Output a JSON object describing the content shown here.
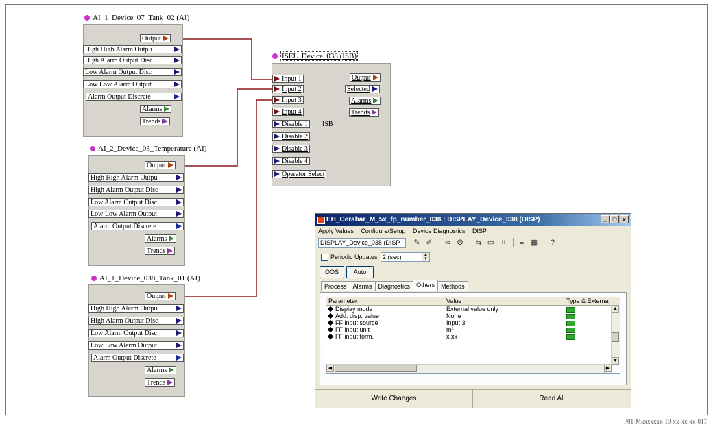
{
  "figure_ref": "P01-Mxxxxxxx-19-xx-xx-xx-017",
  "block_ai_tank02": {
    "title": "AI_1_Device_07_Tank_02 (AI)",
    "outputs": [
      "Output",
      "High High Alarm Outpu",
      "High Alarm Output Disc",
      "Low Alarm Output Disc",
      "Low Low Alarm Output",
      "Alarm Output Discrete",
      "Alarms",
      "Trends"
    ]
  },
  "block_ai_temp": {
    "title": "AI_2_Device_03_Temperature (AI)",
    "outputs": [
      "Output",
      "High High Alarm Outpu",
      "High Alarm Output Disc",
      "Low Alarm Output Disc",
      "Low Low Alarm Output",
      "Alarm Output Discrete",
      "Alarms",
      "Trends"
    ]
  },
  "block_ai_tank01": {
    "title": "AI_1_Device_038_Tank_01 (AI)",
    "outputs": [
      "Output",
      "High High Alarm Outpu",
      "High Alarm Output Disc",
      "Low Alarm Output Disc",
      "Low Low Alarm Output",
      "Alarm Output Discrete",
      "Alarms",
      "Trends"
    ]
  },
  "block_isel": {
    "title": "ISEL_Device_038 (ISB)",
    "inputs": [
      "Input 1",
      "Input 2",
      "Input 3",
      "Input 4",
      "Disable 1",
      "Disable 2",
      "Disable 3",
      "Disable 4",
      "Operator Select"
    ],
    "outputs": [
      "Output",
      "Selected",
      "Alarms",
      "Trends"
    ],
    "tag": "ISB"
  },
  "dialog": {
    "title": "EH_Cerabar_M_5x_fp_number_038 : DISPLAY_Device_038 (DISP)",
    "menu": [
      "Apply Values",
      "Configure/Setup",
      "Device Diagnostics",
      "DISP"
    ],
    "block_combo": "DISPLAY_Device_038 (DISP",
    "periodic_label": "Periodic Updates",
    "periodic_value": "2 (sec)",
    "mode_buttons": [
      "OOS",
      "Auto"
    ],
    "tabs": [
      "Process",
      "Alarms",
      "Diagnostics",
      "Others",
      "Methods"
    ],
    "active_tab": "Others",
    "columns": [
      "Parameter",
      "Value",
      "Type & Externa"
    ],
    "rows": [
      {
        "parameter": "Display mode",
        "value": "External value only"
      },
      {
        "parameter": "Add. disp. value",
        "value": "None"
      },
      {
        "parameter": "FF input source",
        "value": "Input 3"
      },
      {
        "parameter": "FF input unit",
        "value": "m³"
      },
      {
        "parameter": "FF input form.",
        "value": "x.xx"
      }
    ],
    "write_label": "Write Changes",
    "read_label": "Read All"
  },
  "colors": {
    "wire": "#8b1a1a",
    "block_bg": "#d8d5cf",
    "title_bar": "#0a246a"
  }
}
